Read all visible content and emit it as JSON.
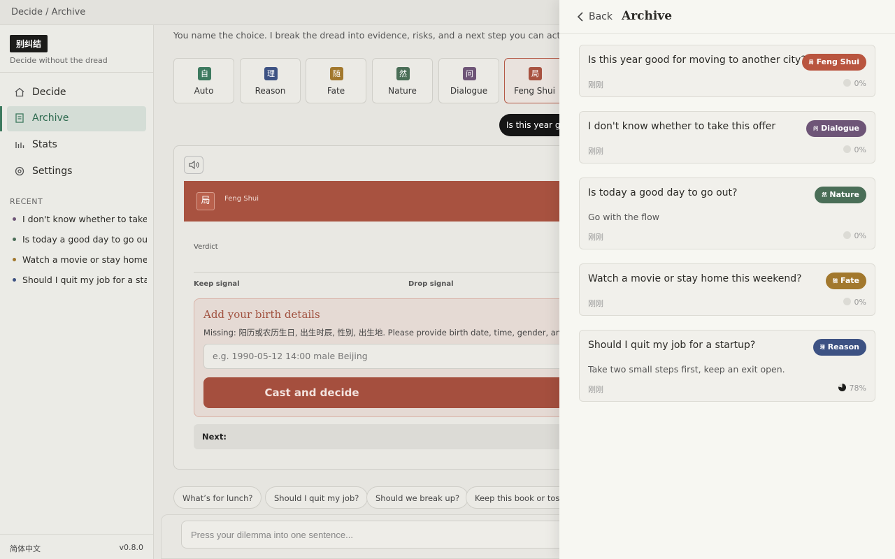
{
  "window": {
    "breadcrumb": "Decide / Archive"
  },
  "sidebar": {
    "brand": "别纠结",
    "tagline": "Decide without the dread",
    "nav": [
      {
        "label": "Decide",
        "icon": "home-icon"
      },
      {
        "label": "Archive",
        "icon": "archive-icon",
        "active": true
      },
      {
        "label": "Stats",
        "icon": "bar-chart-icon"
      },
      {
        "label": "Settings",
        "icon": "gear-icon"
      }
    ],
    "recent_title": "RECENT",
    "recent": [
      {
        "text": "I don't know whether to take this offer",
        "color": "#6e5577"
      },
      {
        "text": "Is today a good day to go out?",
        "color": "#4a6e57"
      },
      {
        "text": "Watch a movie or stay home this weekend?",
        "color": "#a2782d"
      },
      {
        "text": "Should I quit my job for a startup?",
        "color": "#3d5283"
      }
    ],
    "language": "简体中文",
    "version": "v0.8.0"
  },
  "main": {
    "intro": "You name the choice. I break the dread into evidence, risks, and a next step you can act on.",
    "modes": [
      {
        "glyph": "自",
        "label": "Auto",
        "color": "#3d7a5f"
      },
      {
        "glyph": "理",
        "label": "Reason",
        "color": "#3d5283"
      },
      {
        "glyph": "随",
        "label": "Fate",
        "color": "#a2782d"
      },
      {
        "glyph": "然",
        "label": "Nature",
        "color": "#4a6e57"
      },
      {
        "glyph": "问",
        "label": "Dialogue",
        "color": "#6e5577"
      },
      {
        "glyph": "局",
        "label": "Feng Shui",
        "color": "#a85240",
        "active": true
      }
    ],
    "query_pill": "Is this year good for moving to another city?",
    "result": {
      "mode_glyph": "局",
      "mode_label": "Feng Shui",
      "verdict_label": "Verdict",
      "keep_label": "Keep signal",
      "drop_label": "Drop signal",
      "birth": {
        "title": "Add your birth details",
        "missing": "Missing: 阳历或农历生日, 出生时辰, 性别, 出生地. Please provide birth date, time, gender, and birthplace.",
        "placeholder": "e.g. 1990-05-12 14:00 male Beijing",
        "cast_button": "Cast and decide"
      },
      "next_label": "Next:"
    },
    "suggestions": [
      "What’s for lunch?",
      "Should I quit my job?",
      "Should we break up?",
      "Keep this book or toss it?"
    ],
    "composer_placeholder": "Press your dilemma into one sentence..."
  },
  "archive": {
    "back_label": "Back",
    "title": "Archive",
    "entries": [
      {
        "question": "Is this year good for moving to another city?",
        "tag_glyph": "局",
        "tag": "Feng Shui",
        "tag_color": "#b9553f",
        "note": "",
        "time": "刚刚",
        "percent": "0%",
        "percent_value": 0
      },
      {
        "question": "I don't know whether to take this offer",
        "tag_glyph": "问",
        "tag": "Dialogue",
        "tag_color": "#6e5577",
        "note": "",
        "time": "刚刚",
        "percent": "0%",
        "percent_value": 0
      },
      {
        "question": "Is today a good day to go out?",
        "tag_glyph": "然",
        "tag": "Nature",
        "tag_color": "#4a6e57",
        "note": "Go with the flow",
        "time": "刚刚",
        "percent": "0%",
        "percent_value": 0
      },
      {
        "question": "Watch a movie or stay home this weekend?",
        "tag_glyph": "随",
        "tag": "Fate",
        "tag_color": "#a2782d",
        "note": "",
        "time": "刚刚",
        "percent": "0%",
        "percent_value": 0
      },
      {
        "question": "Should I quit my job for a startup?",
        "tag_glyph": "理",
        "tag": "Reason",
        "tag_color": "#3d5283",
        "note": "Take two small steps first, keep an exit open.",
        "time": "刚刚",
        "percent": "78%",
        "percent_value": 78
      }
    ]
  }
}
